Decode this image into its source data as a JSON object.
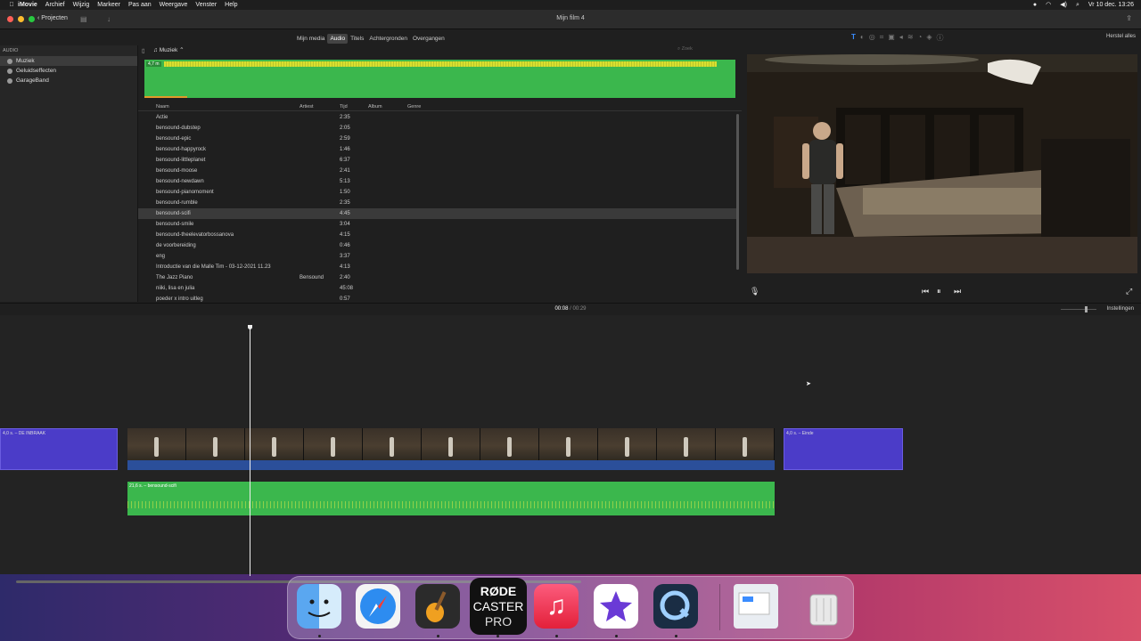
{
  "menubar": {
    "app": "iMovie",
    "items": [
      "Archief",
      "Wijzig",
      "Markeer",
      "Pas aan",
      "Weergave",
      "Venster",
      "Help"
    ],
    "clock": "Vr 10 dec.  13:26"
  },
  "window": {
    "title": "Mijn film 4",
    "projects_button": "Projecten"
  },
  "media_tabs": [
    {
      "label": "Mijn media",
      "active": false
    },
    {
      "label": "Audio",
      "active": true
    },
    {
      "label": "Titels",
      "active": false
    },
    {
      "label": "Achtergronden",
      "active": false
    },
    {
      "label": "Overgangen",
      "active": false
    }
  ],
  "viewer_toolbar": {
    "reset_all": "Herstel alles"
  },
  "sidebar": {
    "header": "AUDIO",
    "items": [
      {
        "label": "Muziek",
        "selected": true
      },
      {
        "label": "Geluidseffecten",
        "selected": false
      },
      {
        "label": "GarageBand",
        "selected": false
      }
    ]
  },
  "browser": {
    "category": "Muziek",
    "search_placeholder": "Zoek",
    "preview_length": "4,7 m",
    "columns": {
      "name": "Naam",
      "artist": "Artiest",
      "time": "Tijd",
      "album": "Album",
      "genre": "Genre"
    },
    "tracks": [
      {
        "name": "Actie",
        "artist": "",
        "time": "2:35"
      },
      {
        "name": "bensound-dubstep",
        "artist": "",
        "time": "2:05"
      },
      {
        "name": "bensound-epic",
        "artist": "",
        "time": "2:59"
      },
      {
        "name": "bensound-happyrock",
        "artist": "",
        "time": "1:46"
      },
      {
        "name": "bensound-littleplanet",
        "artist": "",
        "time": "6:37"
      },
      {
        "name": "bensound-moose",
        "artist": "",
        "time": "2:41"
      },
      {
        "name": "bensound-newdawn",
        "artist": "",
        "time": "5:13"
      },
      {
        "name": "bensound-pianomoment",
        "artist": "",
        "time": "1:50"
      },
      {
        "name": "bensound-rumble",
        "artist": "",
        "time": "2:35"
      },
      {
        "name": "bensound-scifi",
        "artist": "",
        "time": "4:45",
        "selected": true
      },
      {
        "name": "bensound-smile",
        "artist": "",
        "time": "3:04"
      },
      {
        "name": "bensound-theelevatorbossanova",
        "artist": "",
        "time": "4:15"
      },
      {
        "name": "de voorbereiding",
        "artist": "",
        "time": "0:46"
      },
      {
        "name": "eng",
        "artist": "",
        "time": "3:37"
      },
      {
        "name": "Introductie van die Malle Tim - 03-12-2021 11.23",
        "artist": "",
        "time": "4:13"
      },
      {
        "name": "The Jazz Piano",
        "artist": "Bensound",
        "time": "2:40"
      },
      {
        "name": "niiki, lisa en julia",
        "artist": "",
        "time": "45:08"
      },
      {
        "name": "poeder x intro uitleg",
        "artist": "",
        "time": "0:57"
      }
    ]
  },
  "playback": {
    "current": "00:08",
    "total": "00:29",
    "settings": "Instellingen"
  },
  "timeline": {
    "title_clip_left": "4,0 s. – DE INBRAAK",
    "title_clip_right": "4,0 s. – Einde",
    "audio_clip": "21,6 s. – bensound-scifi",
    "thumbnail_count": 11
  },
  "dock": {
    "apps": [
      {
        "name": "Finder"
      },
      {
        "name": "Safari"
      },
      {
        "name": "GarageBand"
      },
      {
        "name": "RØDECaster Pro",
        "lines": [
          "RØDE",
          "CASTER",
          "PRO"
        ]
      },
      {
        "name": "Muziek"
      },
      {
        "name": "iMovie"
      },
      {
        "name": "QuickTime Player"
      },
      {
        "name": "Documenten"
      },
      {
        "name": "Prullenmand"
      }
    ]
  },
  "colors": {
    "accent": "#3a8cff",
    "title_clip": "#4b3cc8",
    "audio_clip": "#3bb74d",
    "video_bar": "#2b4f9a"
  }
}
